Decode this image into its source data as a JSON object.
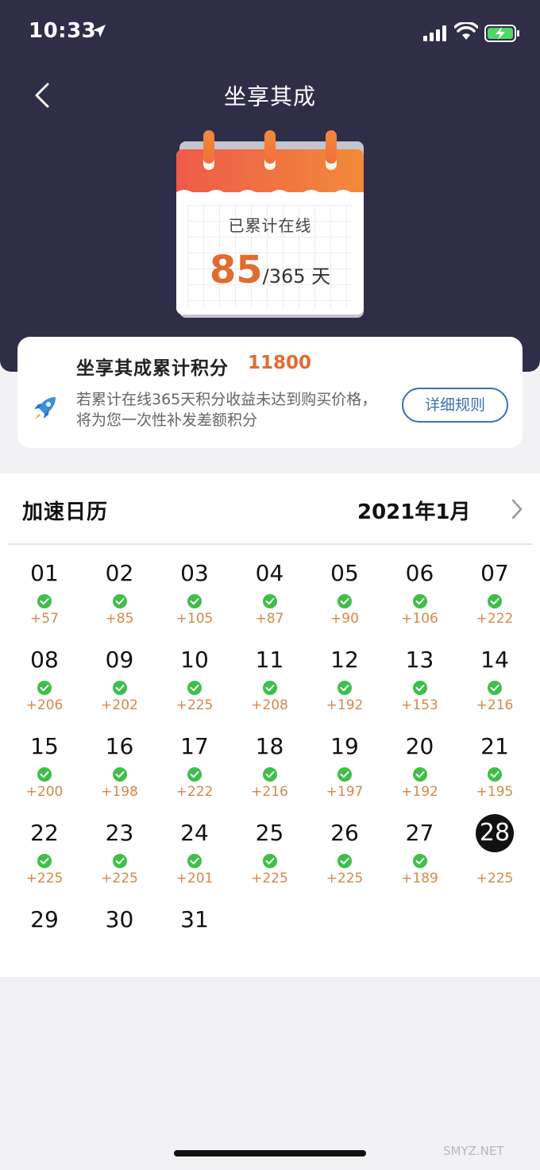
{
  "status_bar": {
    "time": "10:33",
    "icons": [
      "location-icon",
      "signal-icon",
      "wifi-icon",
      "battery-charging-icon"
    ]
  },
  "nav": {
    "title": "坐享其成",
    "back_icon": "chevron-left-icon"
  },
  "summary": {
    "label": "已累计在线",
    "days": "85",
    "total": "/365 天"
  },
  "points_card": {
    "title": "坐享其成累计积分",
    "value": "11800",
    "description": "若累计在线365天积分收益未达到购买价格，将为您一次性补发差额积分",
    "rules_button": "详细规则",
    "icon": "rocket-icon"
  },
  "calendar": {
    "title": "加速日历",
    "month": "2021年1月",
    "next_icon": "chevron-right-icon",
    "days": [
      {
        "day": "01",
        "points": "+57",
        "checked": true
      },
      {
        "day": "02",
        "points": "+85",
        "checked": true
      },
      {
        "day": "03",
        "points": "+105",
        "checked": true
      },
      {
        "day": "04",
        "points": "+87",
        "checked": true
      },
      {
        "day": "05",
        "points": "+90",
        "checked": true
      },
      {
        "day": "06",
        "points": "+106",
        "checked": true
      },
      {
        "day": "07",
        "points": "+222",
        "checked": true
      },
      {
        "day": "08",
        "points": "+206",
        "checked": true
      },
      {
        "day": "09",
        "points": "+202",
        "checked": true
      },
      {
        "day": "10",
        "points": "+225",
        "checked": true
      },
      {
        "day": "11",
        "points": "+208",
        "checked": true
      },
      {
        "day": "12",
        "points": "+192",
        "checked": true
      },
      {
        "day": "13",
        "points": "+153",
        "checked": true
      },
      {
        "day": "14",
        "points": "+216",
        "checked": true
      },
      {
        "day": "15",
        "points": "+200",
        "checked": true
      },
      {
        "day": "16",
        "points": "+198",
        "checked": true
      },
      {
        "day": "17",
        "points": "+222",
        "checked": true
      },
      {
        "day": "18",
        "points": "+216",
        "checked": true
      },
      {
        "day": "19",
        "points": "+197",
        "checked": true
      },
      {
        "day": "20",
        "points": "+192",
        "checked": true
      },
      {
        "day": "21",
        "points": "+195",
        "checked": true
      },
      {
        "day": "22",
        "points": "+225",
        "checked": true
      },
      {
        "day": "23",
        "points": "+225",
        "checked": true
      },
      {
        "day": "24",
        "points": "+201",
        "checked": true
      },
      {
        "day": "25",
        "points": "+225",
        "checked": true
      },
      {
        "day": "26",
        "points": "+225",
        "checked": true
      },
      {
        "day": "27",
        "points": "+189",
        "checked": true
      },
      {
        "day": "28",
        "points": "+225",
        "checked": false,
        "today": true
      },
      {
        "day": "29",
        "points": "",
        "checked": false
      },
      {
        "day": "30",
        "points": "",
        "checked": false
      },
      {
        "day": "31",
        "points": "",
        "checked": false
      }
    ]
  },
  "watermark": "SMYZ.NET",
  "colors": {
    "header_bg": "#2f2d48",
    "accent_orange": "#e26b30",
    "points_orange": "#d4884a",
    "check_green": "#3fbf4a",
    "link_blue": "#3c6db8"
  }
}
